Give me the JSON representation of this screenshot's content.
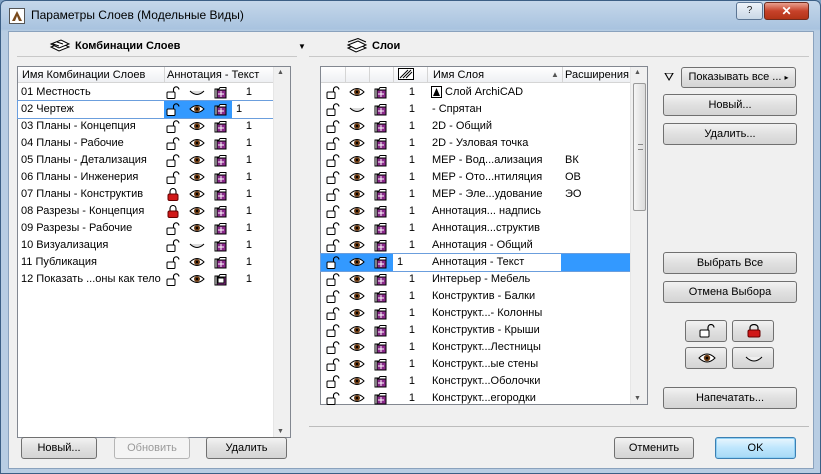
{
  "window": {
    "title": "Параметры Слоев (Модельные Виды)",
    "help_label": "?",
    "close_label": "✕"
  },
  "left_panel": {
    "heading": "Комбинации Слоев",
    "columns": [
      "Имя Комбинации Слоев",
      "Аннотация - Текст"
    ],
    "rows": [
      {
        "name": "01 Местность",
        "lock": "open",
        "vis": "hidden",
        "num": "1"
      },
      {
        "name": "02 Чертеж",
        "lock": "open",
        "vis": "shown",
        "num": "1",
        "selected": true
      },
      {
        "name": "03 Планы - Концепция",
        "lock": "open",
        "vis": "shown",
        "num": "1"
      },
      {
        "name": "04 Планы - Рабочие",
        "lock": "open",
        "vis": "shown",
        "num": "1"
      },
      {
        "name": "05 Планы - Детализация",
        "lock": "open",
        "vis": "shown",
        "num": "1"
      },
      {
        "name": "06 Планы - Инженерия",
        "lock": "open",
        "vis": "shown",
        "num": "1"
      },
      {
        "name": "07 Планы - Конструктив",
        "lock": "locked",
        "vis": "shown",
        "num": "1"
      },
      {
        "name": "08 Разрезы - Концепция",
        "lock": "locked",
        "vis": "shown",
        "num": "1"
      },
      {
        "name": "09 Разрезы - Рабочие",
        "lock": "open",
        "vis": "shown",
        "num": "1"
      },
      {
        "name": "10 Визуализация",
        "lock": "open",
        "vis": "hidden",
        "num": "1"
      },
      {
        "name": "11 Публикация",
        "lock": "open",
        "vis": "shown",
        "num": "1"
      },
      {
        "name": "12 Показать ...оны как тело",
        "lock": "open",
        "vis": "shown",
        "num": "1",
        "special": true
      }
    ],
    "buttons": {
      "new": "Новый...",
      "update": "Обновить",
      "delete": "Удалить"
    }
  },
  "right_panel": {
    "heading": "Слои",
    "columns": [
      "Имя Слоя",
      "Расширения"
    ],
    "rows": [
      {
        "name": "Слой ArchiCAD",
        "num": "1",
        "vis": "shown",
        "ext": "",
        "archicad": true
      },
      {
        "name": "- Спрятан",
        "num": "1",
        "vis": "hidden",
        "ext": ""
      },
      {
        "name": "2D - Общий",
        "num": "1",
        "vis": "shown",
        "ext": ""
      },
      {
        "name": "2D - Узловая точка",
        "num": "1",
        "vis": "shown",
        "ext": ""
      },
      {
        "name": "MEP - Вод...ализация",
        "num": "1",
        "vis": "shown",
        "ext": "ВК"
      },
      {
        "name": "MEP - Ото...нтиляция",
        "num": "1",
        "vis": "shown",
        "ext": "ОВ"
      },
      {
        "name": "MEP - Эле...удование",
        "num": "1",
        "vis": "shown",
        "ext": "ЭО"
      },
      {
        "name": "Аннотация... надпись",
        "num": "1",
        "vis": "shown",
        "ext": ""
      },
      {
        "name": "Аннотация...структив",
        "num": "1",
        "vis": "shown",
        "ext": ""
      },
      {
        "name": "Аннотация - Общий",
        "num": "1",
        "vis": "shown",
        "ext": ""
      },
      {
        "name": "Аннотация - Текст",
        "num": "1",
        "vis": "shown",
        "ext": "",
        "selected": true
      },
      {
        "name": "Интерьер - Мебель",
        "num": "1",
        "vis": "shown",
        "ext": ""
      },
      {
        "name": "Конструктив - Балки",
        "num": "1",
        "vis": "shown",
        "ext": ""
      },
      {
        "name": "Конструкт...- Колонны",
        "num": "1",
        "vis": "shown",
        "ext": ""
      },
      {
        "name": "Конструктив - Крыши",
        "num": "1",
        "vis": "shown",
        "ext": ""
      },
      {
        "name": "Конструкт...Лестницы",
        "num": "1",
        "vis": "shown",
        "ext": ""
      },
      {
        "name": "Конструкт...ые стены",
        "num": "1",
        "vis": "shown",
        "ext": ""
      },
      {
        "name": "Конструкт...Оболочки",
        "num": "1",
        "vis": "shown",
        "ext": ""
      },
      {
        "name": "Конструкт...егородки",
        "num": "1",
        "vis": "shown",
        "ext": ""
      }
    ]
  },
  "side_buttons": {
    "show_all": "Показывать все ...",
    "new": "Новый...",
    "delete": "Удалить...",
    "select_all": "Выбрать Все",
    "deselect": "Отмена Выбора",
    "print": "Напечатать..."
  },
  "dialog_buttons": {
    "cancel": "Отменить",
    "ok": "OK"
  },
  "colors": {
    "selection": "#3399ff",
    "lock_red": "#d01818",
    "folder_purple": "#8b2a8b"
  }
}
